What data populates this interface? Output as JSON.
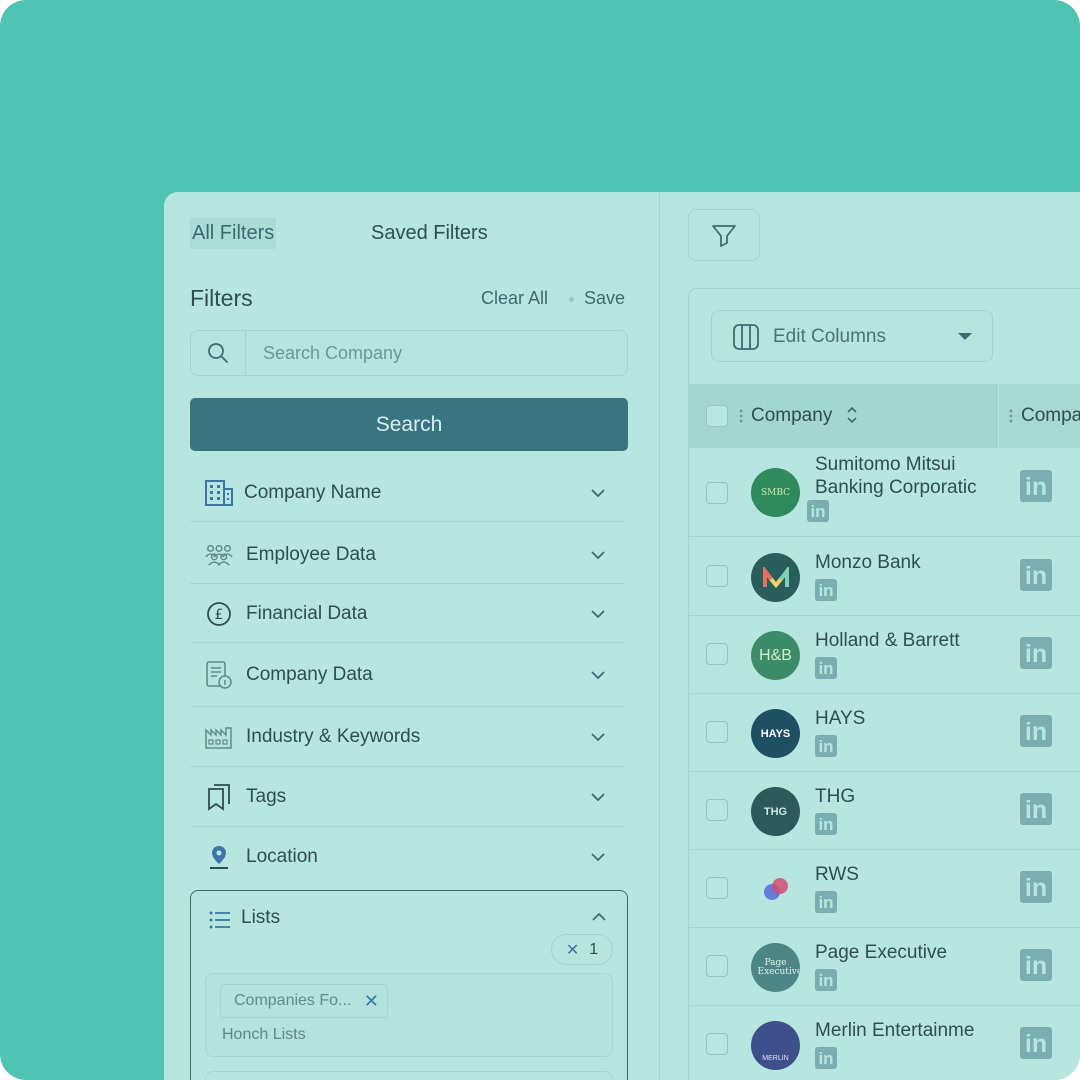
{
  "tabs": {
    "all_filters": "All Filters",
    "saved_filters": "Saved Filters"
  },
  "filters": {
    "title": "Filters",
    "clear_all": "Clear All",
    "save": "Save",
    "search_placeholder": "Search Company",
    "search_button": "Search",
    "facets": [
      {
        "label": "Company Name",
        "icon": "building-icon"
      },
      {
        "label": "Employee Data",
        "icon": "people-group-icon"
      },
      {
        "label": "Financial Data",
        "icon": "pound-coin-icon"
      },
      {
        "label": "Company Data",
        "icon": "document-info-icon"
      },
      {
        "label": "Industry & Keywords",
        "icon": "factory-icon"
      },
      {
        "label": "Tags",
        "icon": "bookmarks-icon"
      },
      {
        "label": "Location",
        "icon": "location-pin-icon"
      }
    ],
    "lists": {
      "label": "Lists",
      "count": "1",
      "chip": "Companies Fo...",
      "sublabel": "Honch Lists"
    }
  },
  "table": {
    "edit_columns": "Edit Columns",
    "columns": [
      "Company",
      "Compa"
    ],
    "rows": [
      {
        "name": "Sumitomo Mitsui Banking Corporatic",
        "logo_text": "SMBC",
        "logo_color": "#2f8a5c"
      },
      {
        "name": "Monzo Bank",
        "logo_text": "M",
        "logo_color": "#2a5e5c"
      },
      {
        "name": "Holland & Barrett",
        "logo_text": "H&B",
        "logo_color": "#3c8c6a"
      },
      {
        "name": "HAYS",
        "logo_text": "HAYS",
        "logo_color": "#1f4f63"
      },
      {
        "name": "THG",
        "logo_text": "THG",
        "logo_color": "#2c5a5a"
      },
      {
        "name": "RWS",
        "logo_text": "",
        "logo_color": "#b7e6e0"
      },
      {
        "name": "Page Executive",
        "logo_text": "Page Executive",
        "logo_color": "#4d8785"
      },
      {
        "name": "Merlin Entertainme",
        "logo_text": "MERLIN",
        "logo_color": "#3e4f8c"
      }
    ],
    "linkedin_label": "in"
  },
  "colors": {
    "background": "#50c4b3",
    "panel": "#b7e6e0",
    "primary_button": "#3b7481",
    "text": "#2d4e52"
  }
}
